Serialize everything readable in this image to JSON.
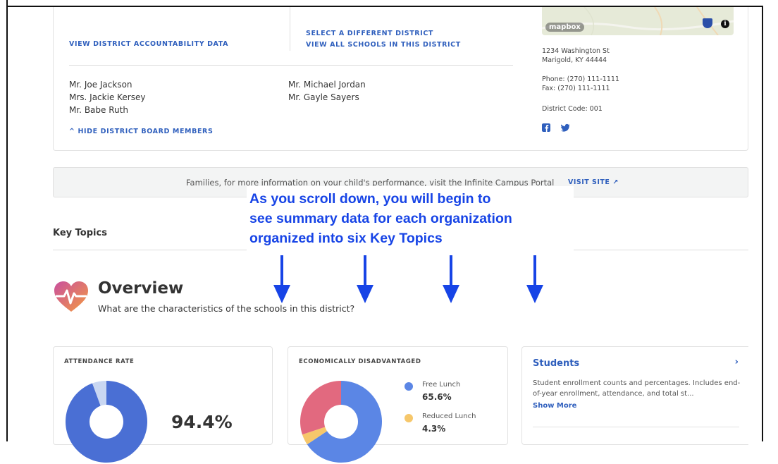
{
  "district_links": {
    "accountability": "VIEW DISTRICT ACCOUNTABILITY DATA",
    "select_district": "SELECT A DIFFERENT DISTRICT",
    "view_all_schools": "VIEW ALL SCHOOLS IN THIS DISTRICT"
  },
  "board_members": {
    "column1": [
      "Mr. Joe Jackson",
      "Mrs. Jackie Kersey",
      "Mr. Babe Ruth"
    ],
    "column2": [
      "Mr. Michael Jordan",
      "Mr. Gayle Sayers"
    ],
    "hide_label": "^ HIDE DISTRICT BOARD MEMBERS"
  },
  "map": {
    "attribution": "mapbox",
    "info_glyph": "i"
  },
  "contact": {
    "address_line1": "1234 Washington St",
    "address_line2": "Marigold, KY 44444",
    "phone": "Phone: (270) 111-1111",
    "fax": "Fax: (270) 111-1111",
    "district_code": "District Code: 001"
  },
  "social": {
    "facebook_icon": "facebook-icon",
    "twitter_icon": "twitter-icon"
  },
  "banner": {
    "text": "Families, for more information on your child's performance, visit the Infinite Campus Portal",
    "link": "VISIT SITE",
    "link_icon": "↗"
  },
  "key_topics": {
    "title": "Key Topics"
  },
  "annotation": {
    "lines": [
      "As you scroll down, you will begin to",
      "see summary data  for each organization",
      "organized into six Key Topics"
    ],
    "color": "#1744e6"
  },
  "overview": {
    "title": "Overview",
    "subtitle": "What are the characteristics of the schools in this district?"
  },
  "cards": {
    "attendance": {
      "title": "ATTENDANCE RATE",
      "value": "94.4%",
      "rate": 0.944
    },
    "economic": {
      "title": "ECONOMICALLY DISADVANTAGED",
      "legend": [
        {
          "label": "Free Lunch",
          "value": "65.6%",
          "share": 0.656,
          "color": "#5b86e5"
        },
        {
          "label": "Reduced Lunch",
          "value": "4.3%",
          "share": 0.043,
          "color": "#f6c76b"
        }
      ],
      "other_color": "#e2697f"
    },
    "students": {
      "title": "Students",
      "description": "Student enrollment counts and percentages. Includes end-of-year enrollment, attendance, and total st...",
      "show_more": "Show More",
      "chevron": "›"
    }
  },
  "colors": {
    "accent": "#2f5fbd",
    "attendance_fill": "#4a6fd4",
    "attendance_rest": "#c9d7f2"
  }
}
